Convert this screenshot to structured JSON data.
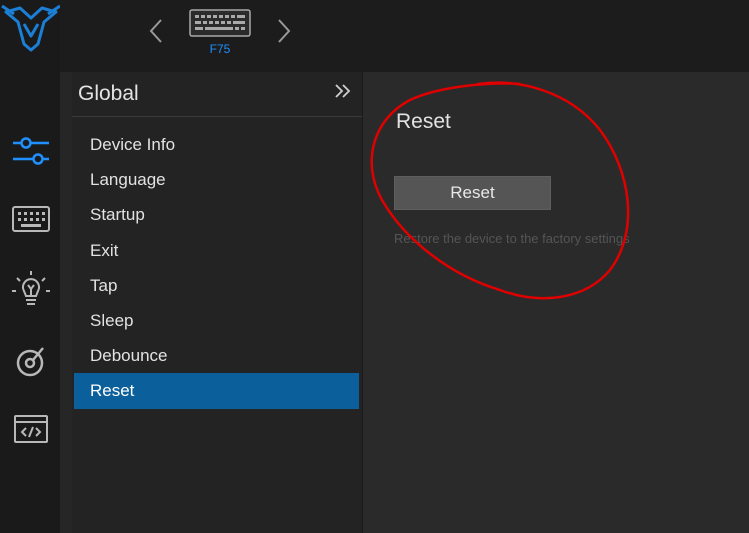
{
  "header": {
    "device_name": "F75"
  },
  "rail": {
    "items": [
      {
        "icon": "sliders-icon",
        "active": true
      },
      {
        "icon": "keyboard-icon",
        "active": false
      },
      {
        "icon": "lightbulb-icon",
        "active": false
      },
      {
        "icon": "macro-icon",
        "active": false
      },
      {
        "icon": "code-icon",
        "active": false
      }
    ]
  },
  "panel": {
    "title": "Global",
    "collapse_icon": "double-chevron-right-icon",
    "items": [
      {
        "label": "Device Info"
      },
      {
        "label": "Language"
      },
      {
        "label": "Startup"
      },
      {
        "label": "Exit"
      },
      {
        "label": "Tap"
      },
      {
        "label": "Sleep"
      },
      {
        "label": "Debounce"
      },
      {
        "label": "Reset",
        "active": true
      }
    ]
  },
  "content": {
    "title": "Reset",
    "button_label": "Reset",
    "hint": "Restore the device to the factory settings"
  },
  "colors": {
    "accent": "#1e90ff",
    "active_item": "#0b5f9a",
    "annotation": "#e00000"
  }
}
